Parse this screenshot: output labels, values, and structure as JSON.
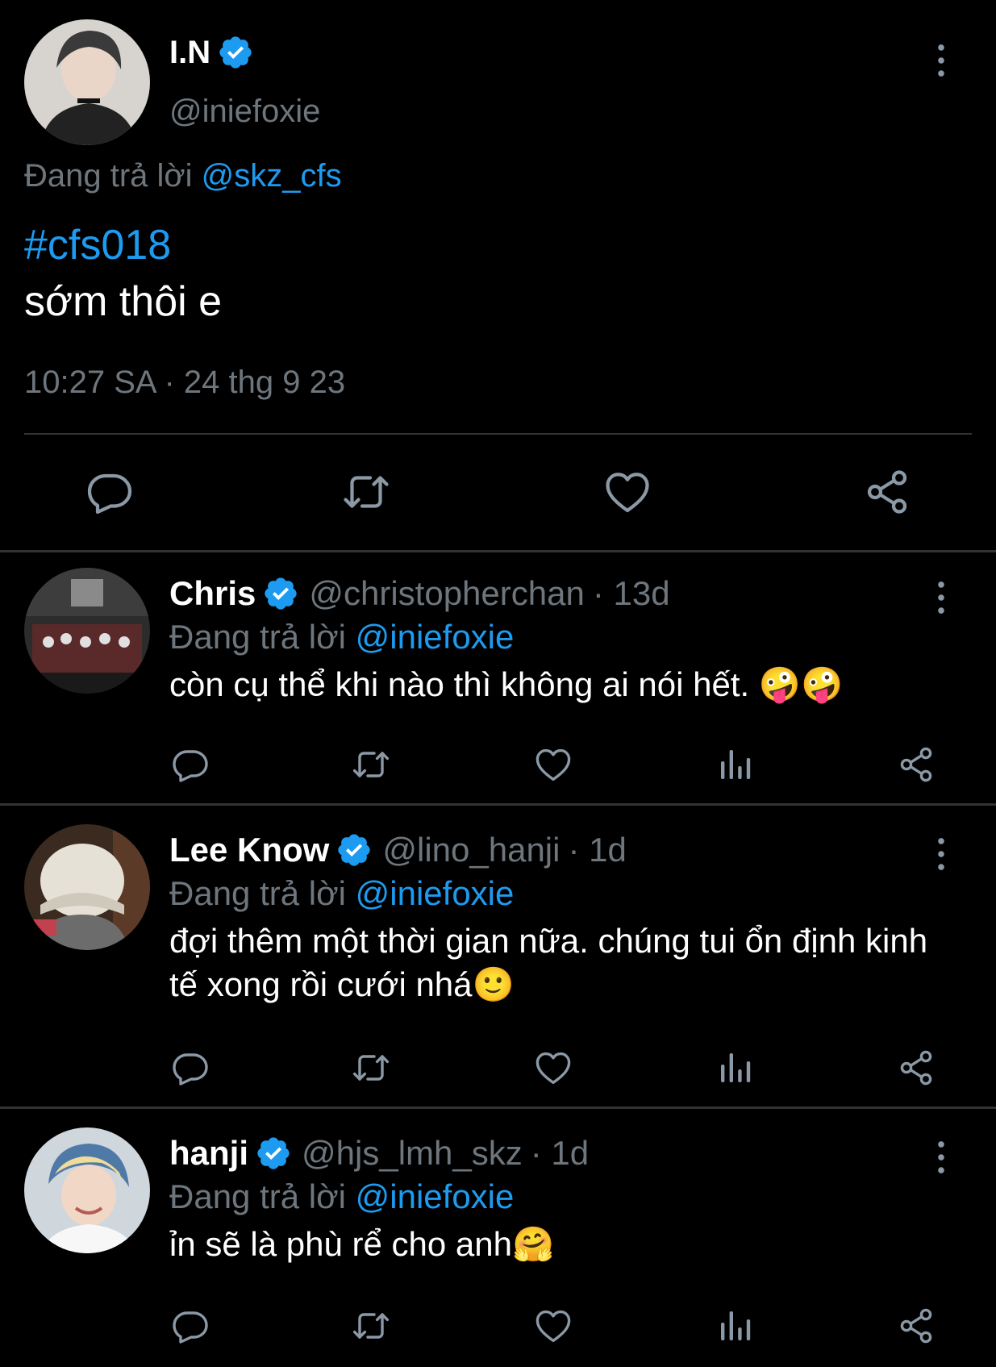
{
  "colors": {
    "accent": "#1d9bf0",
    "muted": "#6e767d",
    "background": "#000000",
    "divider": "#2f3336"
  },
  "main_tweet": {
    "name": "I.N",
    "handle": "@iniefoxie",
    "replying_prefix": "Đang trả lời",
    "replying_to": "@skz_cfs",
    "hashtag": "#cfs018",
    "text": "sớm thôi e",
    "timestamp": "10:27 SA · 24 thg 9 23",
    "actions": [
      "reply-icon",
      "retweet-icon",
      "like-icon",
      "share-icon"
    ]
  },
  "replies": [
    {
      "name": "Chris",
      "handle": "@christopherchan",
      "age": "· 13d",
      "replying_prefix": "Đang trả lời",
      "replying_to": "@iniefoxie",
      "text": "còn cụ thể khi nào thì không ai nói hết. 🤪🤪"
    },
    {
      "name": "Lee Know",
      "handle": "@lino_hanji",
      "age": "· 1d",
      "replying_prefix": "Đang trả lời",
      "replying_to": "@iniefoxie",
      "text": "đợi thêm một thời gian nữa. chúng tui ổn định kinh tế xong rồi cưới nhá🙂"
    },
    {
      "name": "hanji",
      "handle": "@hjs_lmh_skz",
      "age": "· 1d",
      "replying_prefix": "Đang trả lời",
      "replying_to": "@iniefoxie",
      "text": "ỉn sẽ là phù rể cho anh🤗"
    }
  ],
  "reply_actions": [
    "reply-icon",
    "retweet-icon",
    "like-icon",
    "views-icon",
    "share-icon"
  ]
}
